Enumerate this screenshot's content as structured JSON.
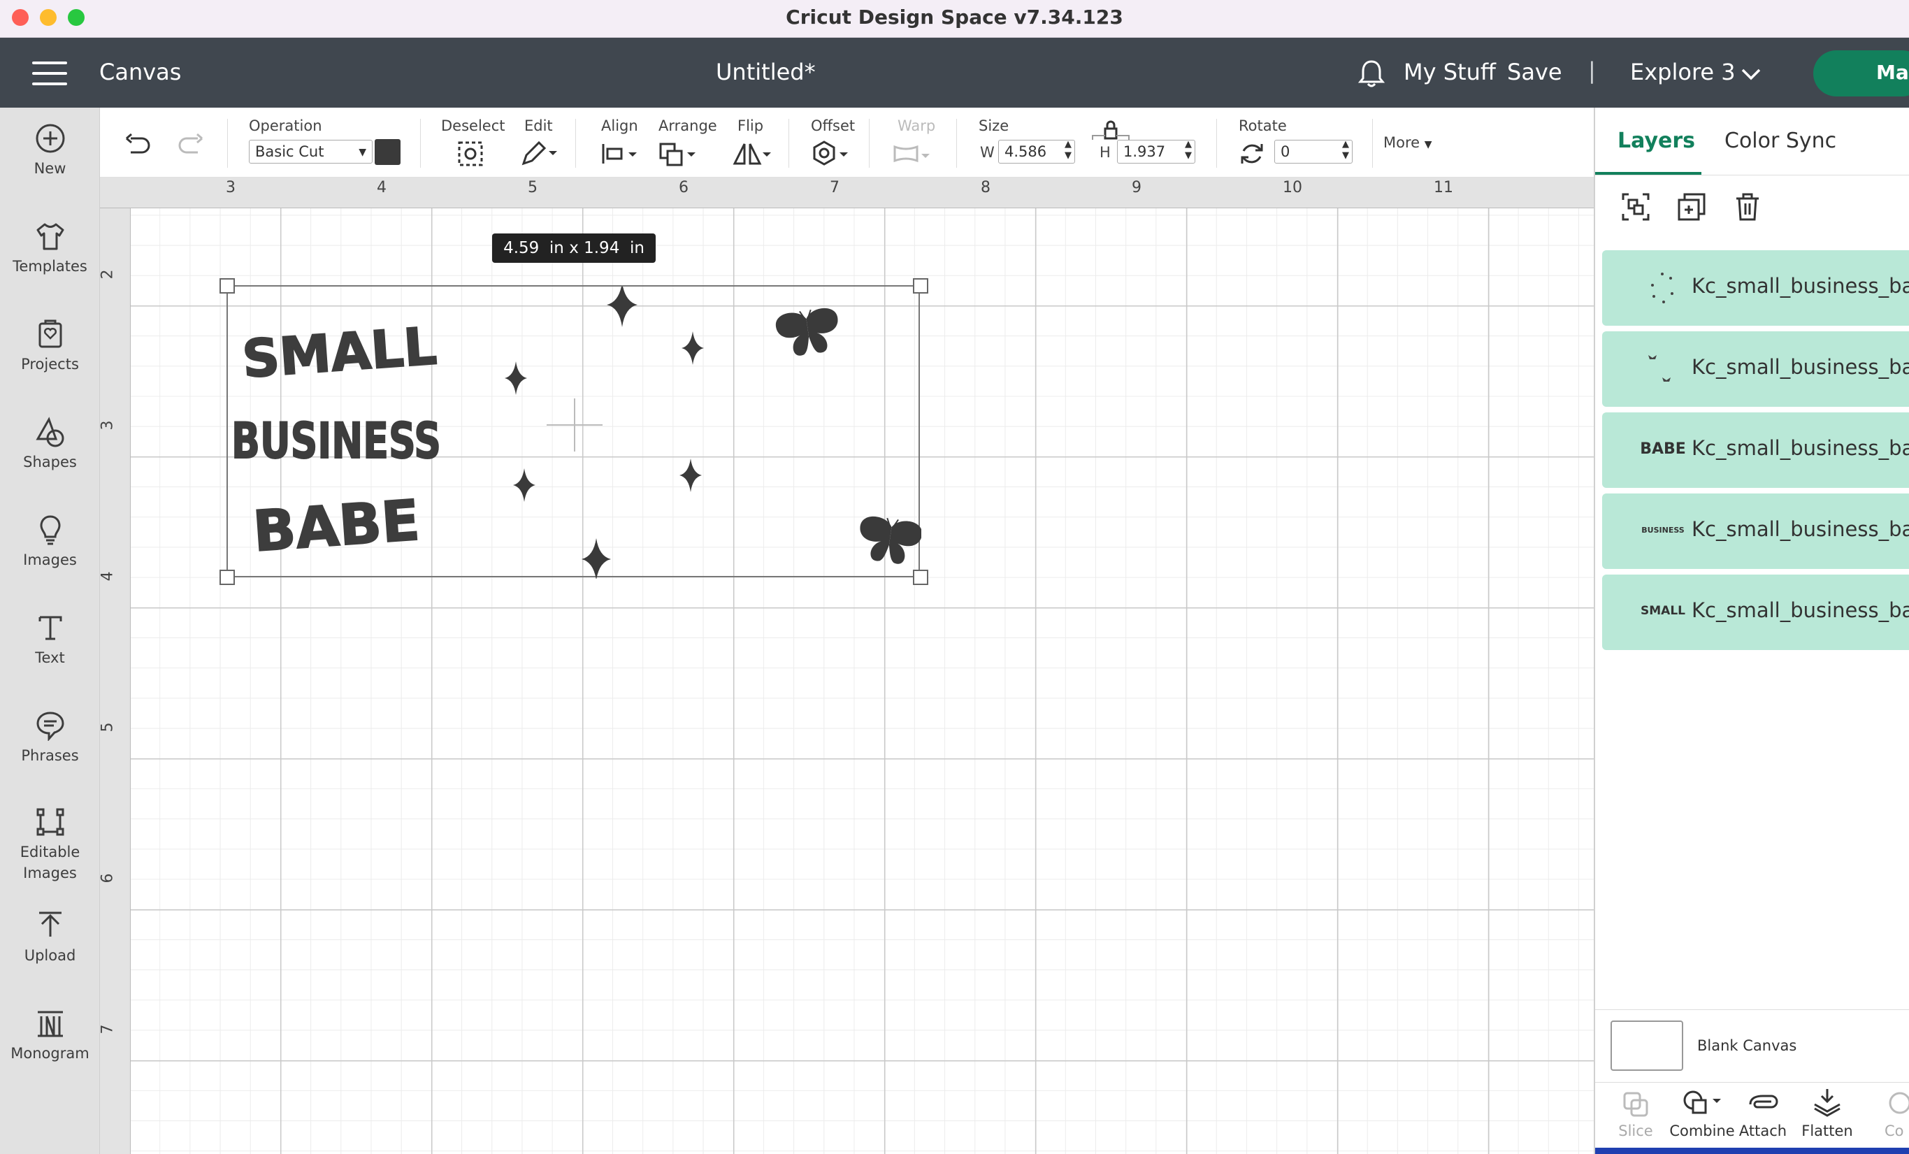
{
  "window": {
    "title": "Cricut Design Space  v7.34.123"
  },
  "appbar": {
    "menu_label": "Canvas",
    "doc_title": "Untitled*",
    "my_stuff": "My Stuff",
    "save": "Save",
    "separator": "|",
    "machine": "Explore 3",
    "make_button": "Mak"
  },
  "leftbar": {
    "items": [
      {
        "label": "New",
        "icon": "plus-circle-icon"
      },
      {
        "label": "Templates",
        "icon": "tshirt-icon"
      },
      {
        "label": "Projects",
        "icon": "projects-icon"
      },
      {
        "label": "Shapes",
        "icon": "shapes-icon"
      },
      {
        "label": "Images",
        "icon": "bulb-icon"
      },
      {
        "label": "Text",
        "icon": "text-icon"
      },
      {
        "label": "Phrases",
        "icon": "speech-icon"
      },
      {
        "label": "Editable\nImages",
        "icon": "vector-icon"
      },
      {
        "label": "Upload",
        "icon": "upload-icon"
      },
      {
        "label": "Monogram",
        "icon": "monogram-icon"
      }
    ]
  },
  "toolbar": {
    "operation_label": "Operation",
    "operation_value": "Basic Cut",
    "operation_color": "#3a3a3a",
    "deselect_label": "Deselect",
    "edit_label": "Edit",
    "align_label": "Align",
    "arrange_label": "Arrange",
    "flip_label": "Flip",
    "offset_label": "Offset",
    "warp_label": "Warp",
    "size_label": "Size",
    "w_label": "W",
    "w_value": "4.586",
    "h_label": "H",
    "h_value": "1.937",
    "rotate_label": "Rotate",
    "rotate_value": "0",
    "more_label": "More"
  },
  "rulers": {
    "horizontal": [
      "3",
      "4",
      "5",
      "6",
      "7",
      "8",
      "9",
      "10",
      "11"
    ],
    "vertical": [
      "2",
      "3",
      "4",
      "5",
      "6",
      "7"
    ]
  },
  "canvas": {
    "size_tooltip": "4.59  in x 1.94  in",
    "design_words": [
      "SMALL",
      "BUSINESS",
      "BABE"
    ]
  },
  "panel": {
    "tabs": [
      "Layers",
      "Color Sync"
    ],
    "active_tab": "Layers",
    "layers": [
      {
        "name": "Kc_small_business_babe",
        "thumb": "sparkles"
      },
      {
        "name": "Kc_small_business_babe",
        "thumb": "butterflies"
      },
      {
        "name": "Kc_small_business_babe",
        "thumb": "BABE"
      },
      {
        "name": "Kc_small_business_babe",
        "thumb": "BUSINESS"
      },
      {
        "name": "Kc_small_business_babe",
        "thumb": "SMALL"
      }
    ],
    "blank_canvas": "Blank Canvas",
    "bottom_tools": [
      "Slice",
      "Combine",
      "Attach",
      "Flatten",
      "Co"
    ]
  },
  "colors": {
    "layer_bg": "#b9e8d7",
    "accent_green": "#12805c",
    "appbar": "#40474f"
  }
}
